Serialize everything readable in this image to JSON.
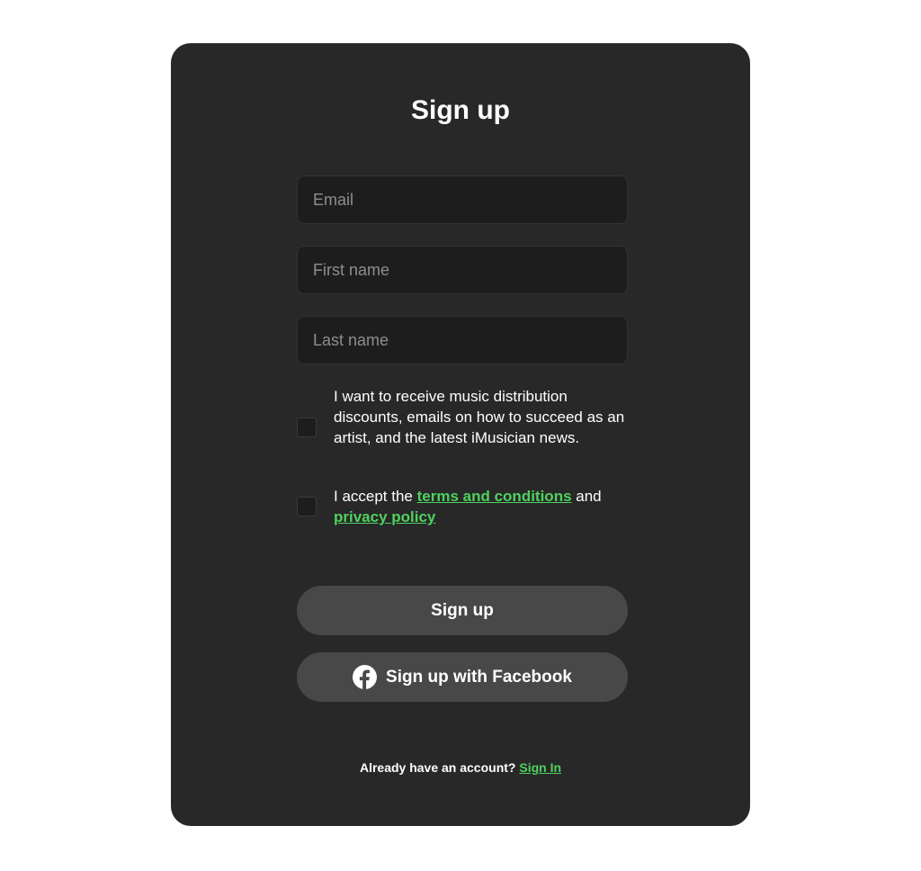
{
  "page": {
    "title": "Sign up"
  },
  "form": {
    "email_placeholder": "Email",
    "first_name_placeholder": "First name",
    "last_name_placeholder": "Last name",
    "newsletter_label": "I want to receive music distribution discounts, emails on how to succeed as an artist, and the latest iMusician news.",
    "terms_prefix": "I accept the ",
    "terms_link": "terms and conditions",
    "terms_middle": " and",
    "privacy_link": "privacy policy"
  },
  "actions": {
    "signup_label": "Sign up",
    "facebook_label": "Sign up with Facebook",
    "facebook_icon": "facebook-icon"
  },
  "footer": {
    "prompt": "Already have an account? ",
    "signin_link": "Sign In"
  },
  "colors": {
    "background": "#ffffff",
    "card": "#282828",
    "field": "#1d1d1d",
    "button": "#484848",
    "link_accent": "#4fd15e"
  }
}
